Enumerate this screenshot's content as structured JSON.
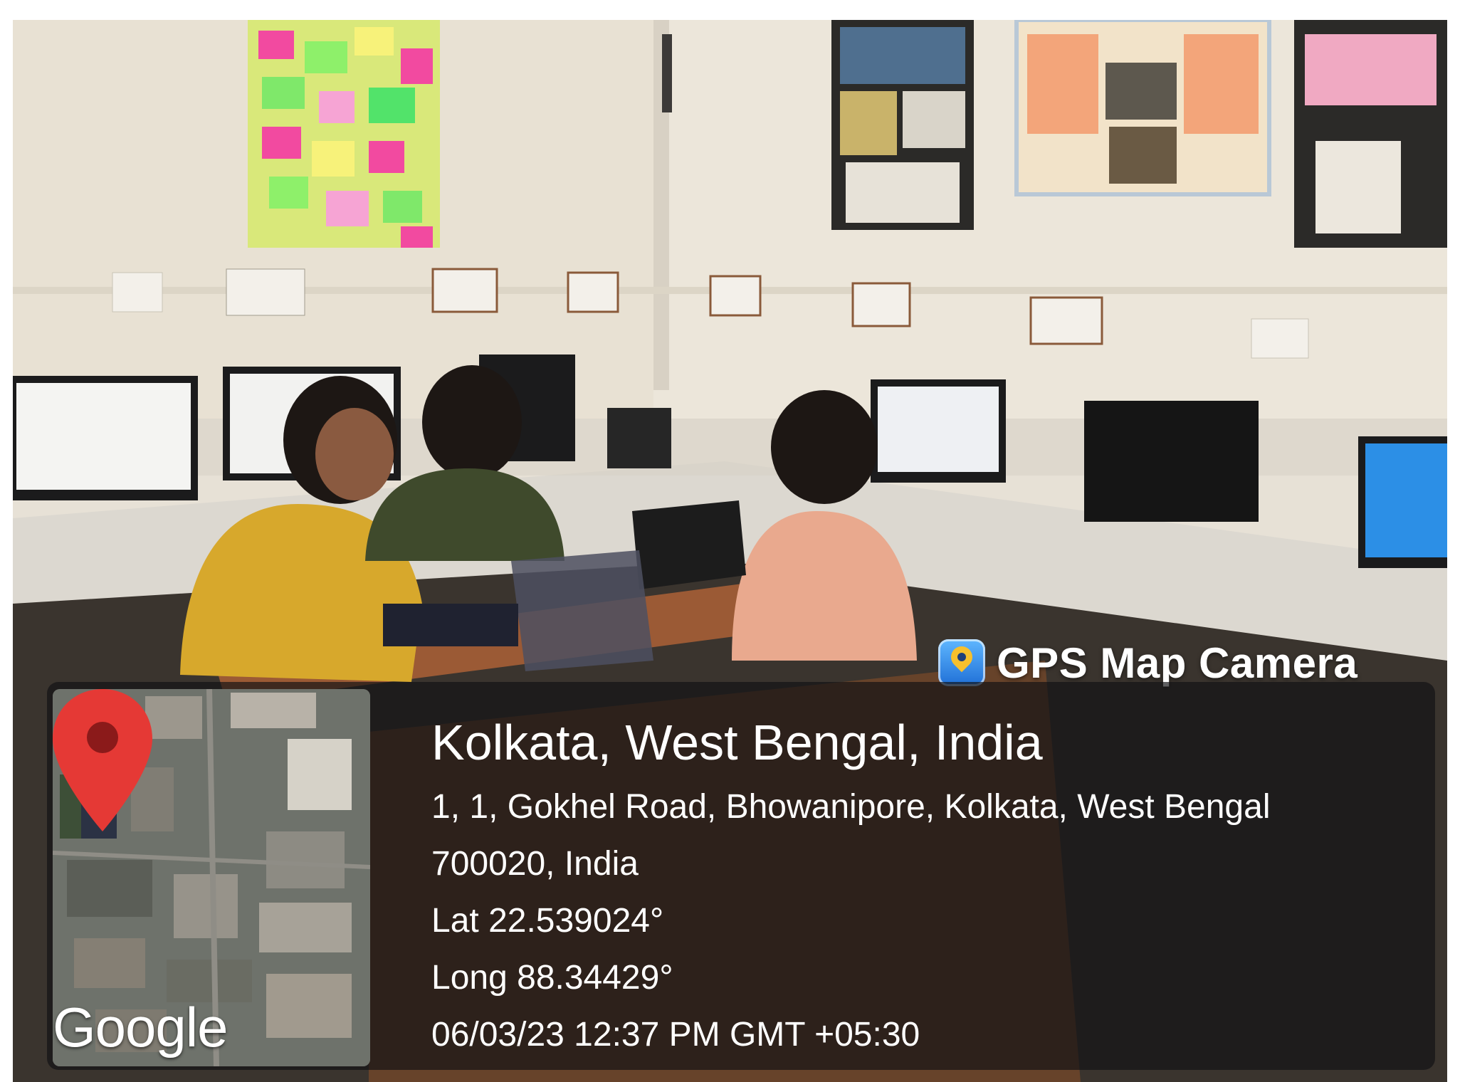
{
  "watermark": {
    "app_name": "GPS Map Camera",
    "icon": "gps-map-camera-icon"
  },
  "map": {
    "brand": "Google",
    "pin_icon": "map-pin-icon",
    "pin_color": "#e53935"
  },
  "location": {
    "title": "Kolkata, West Bengal, India",
    "address_line1": "1, 1, Gokhel Road, Bhowanipore, Kolkata, West Bengal",
    "address_line2": "700020, India",
    "latitude": "Lat 22.539024°",
    "longitude": "Long 88.34429°",
    "timestamp": "06/03/23 12:37 PM GMT +05:30"
  }
}
